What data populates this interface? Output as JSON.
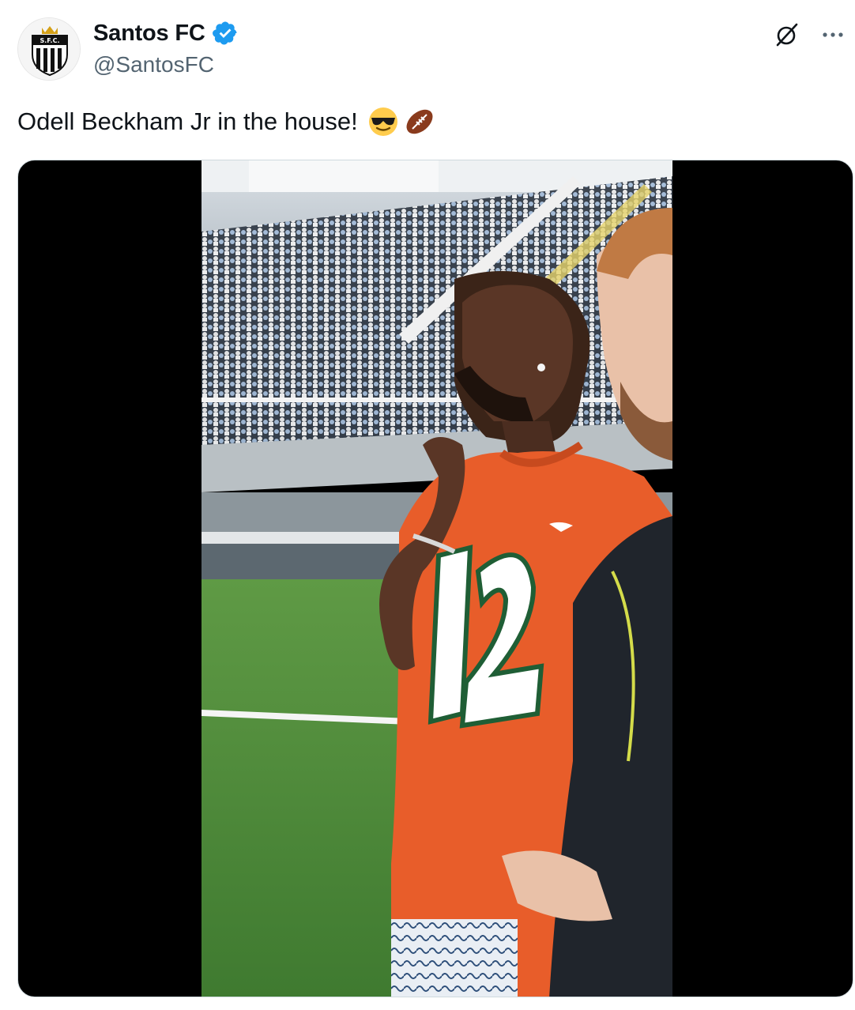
{
  "author": {
    "name": "Santos FC",
    "handle": "@SantosFC",
    "verified": true,
    "avatar_icon": "santos-crest-icon"
  },
  "actions": {
    "grok_icon": "grok-icon",
    "more_icon": "more-dots-icon"
  },
  "tweet": {
    "text": "Odell Beckham Jr in the house!",
    "emojis": [
      "smiling-face-with-sunglasses",
      "american-football"
    ]
  },
  "media": {
    "type": "video",
    "subject": "stadium-sideline-scene"
  },
  "colors": {
    "verified_blue": "#1d9bf0",
    "handle_gray": "#536471",
    "jersey_orange": "#e85d2a",
    "pitch_green": "#4f8a3a"
  }
}
